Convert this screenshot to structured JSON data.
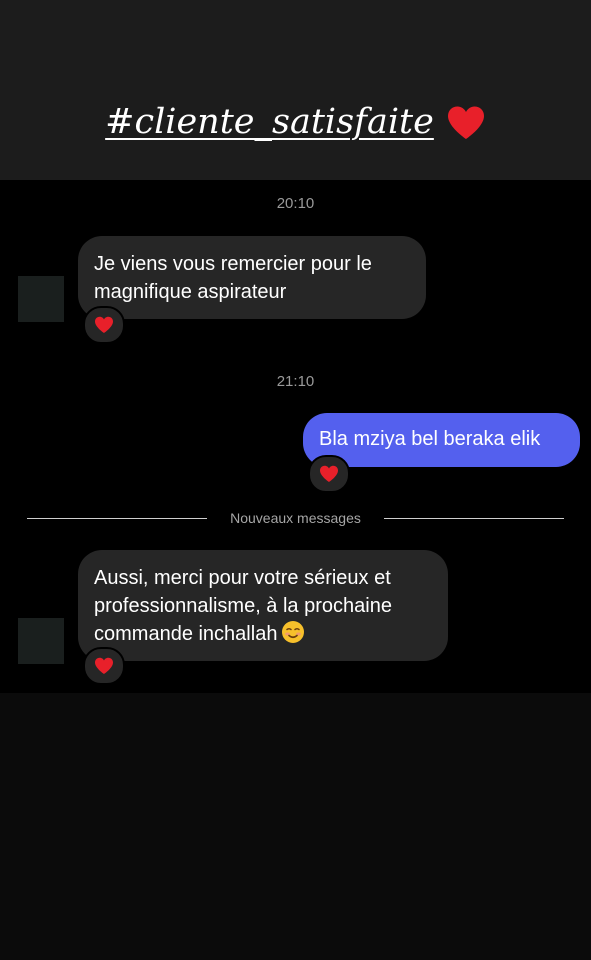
{
  "story": {
    "caption": "#cliente_satisfaite",
    "caption_emoji": "heart-icon"
  },
  "chat": {
    "messages": [
      {
        "timestamp": "20:10",
        "direction": "incoming",
        "text": "Je viens vous remercier pour le\nmagnifique aspirateur",
        "reaction": "heart-icon"
      },
      {
        "timestamp": "21:10",
        "direction": "outgoing",
        "text": "Bla mziya bel beraka elik",
        "reaction": "heart-icon"
      },
      {
        "direction": "incoming",
        "text": "Aussi, merci pour votre sérieux et\nprofessionnalisme, à la prochaine\ncommande inchallah",
        "emoji": "smiling-face-icon",
        "reaction": "heart-icon"
      }
    ],
    "new_messages_divider": "Nouveaux messages"
  },
  "colors": {
    "outgoing_bubble": "#5460ee",
    "incoming_bubble": "#262626",
    "heart": "#e8202a",
    "background": "#000000"
  }
}
